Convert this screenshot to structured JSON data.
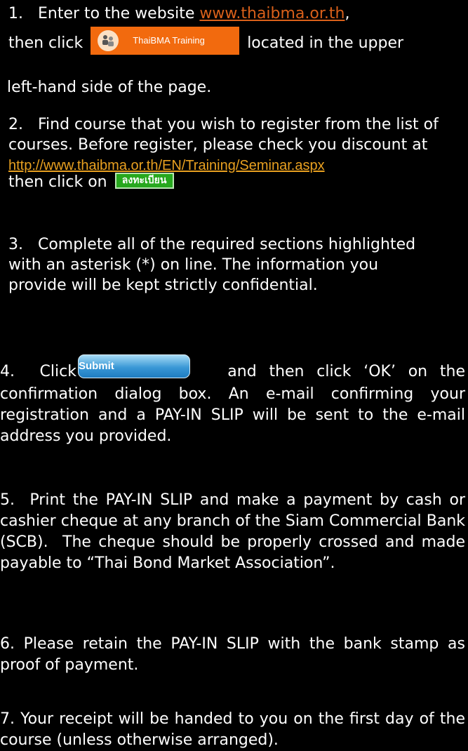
{
  "step1": {
    "prefix": "1.   Enter to the website ",
    "url": "www.thaibma.or.th",
    "after_url": ",",
    "click_word": "then click ",
    "button_label": "ThaiBMA Training",
    "suffix": " located in the upper",
    "line2": "left-hand side of the page."
  },
  "step2": {
    "text": "2.   Find course that you wish to register from the list of courses. Before register, please check you discount at",
    "url": "http://www.thaibma.or.th/EN/Training/Seminar.aspx",
    "click_text": "then click on ",
    "button_label": "ลงทะเบียน"
  },
  "step3": {
    "text": "3.   Complete all of the required sections highlighted with an asterisk (*) on line. The information you provide will be kept strictly confidential."
  },
  "step4": {
    "prefix": "4.  Click",
    "button_label": "Submit",
    "suffix": "   and then click ‘OK’ on the confirmation dialog box. An e-mail confirming your registration and a PAY-IN SLIP will be sent to the e-mail address you provided."
  },
  "step5": {
    "text": "5.  Print the PAY-IN SLIP and make a payment by cash or cashier cheque at any branch of the Siam Commercial Bank (SCB).  The cheque should be properly crossed and made payable to “Thai Bond Market Association”."
  },
  "step6": {
    "text": "6. Please retain the PAY-IN SLIP with the bank stamp as proof of payment."
  },
  "step7": {
    "text": "7. Your receipt will be handed to you on the first day of the course (unless otherwise arranged)."
  }
}
